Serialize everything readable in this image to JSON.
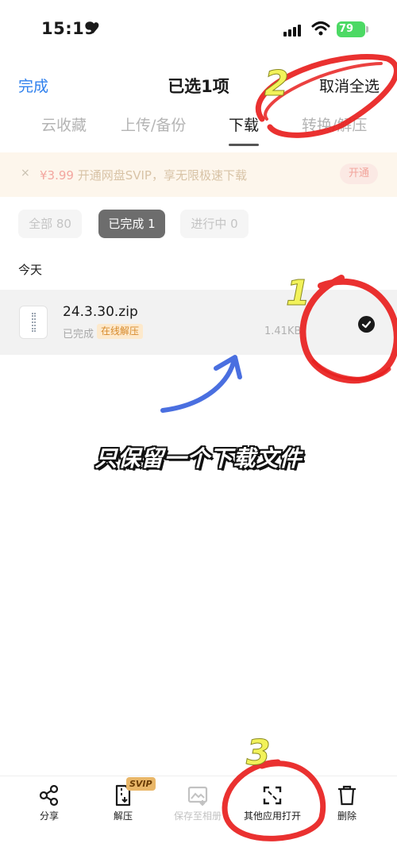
{
  "status_bar": {
    "time": "15:19",
    "battery": "79"
  },
  "nav": {
    "left_label": "完成",
    "title": "已选1项",
    "right_label": "取消全选"
  },
  "tabs": [
    {
      "label": "云收藏"
    },
    {
      "label": "上传/备份"
    },
    {
      "label": "下载"
    },
    {
      "label": "转换/解压"
    }
  ],
  "banner": {
    "close": "×",
    "price": "¥3.99",
    "text": " 开通网盘SVIP，享无限极速下载",
    "button": "开通"
  },
  "filters": [
    {
      "label": "全部 80",
      "active": false
    },
    {
      "label": "已完成 1",
      "active": true
    },
    {
      "label": "进行中 0",
      "active": false
    }
  ],
  "section": {
    "label": "今天"
  },
  "file": {
    "name": "24.3.30.zip",
    "status": "已完成",
    "badge": "在线解压",
    "size": "1.41KB",
    "selected": true
  },
  "caption": "只保留一个下载文件",
  "toolbar": {
    "items": [
      {
        "label": "分享",
        "icon": "share-icon",
        "enabled": true
      },
      {
        "label": "解压",
        "icon": "unzip-icon",
        "enabled": true
      },
      {
        "label": "保存至相册",
        "icon": "save-photo-icon",
        "enabled": false
      },
      {
        "label": "其他应用打开",
        "icon": "open-with-icon",
        "enabled": true
      },
      {
        "label": "删除",
        "icon": "trash-icon",
        "enabled": true
      }
    ],
    "svip_badge": "SVIP"
  },
  "annotations": [
    {
      "number": "1"
    },
    {
      "number": "2"
    },
    {
      "number": "3"
    }
  ],
  "colors": {
    "accent_blue": "#2f80ed",
    "annotation_red": "#e8201e",
    "annotation_yellow": "#f2f25a",
    "arrow_blue": "#4a6fe0",
    "active_chip": "#6d6d6d"
  }
}
